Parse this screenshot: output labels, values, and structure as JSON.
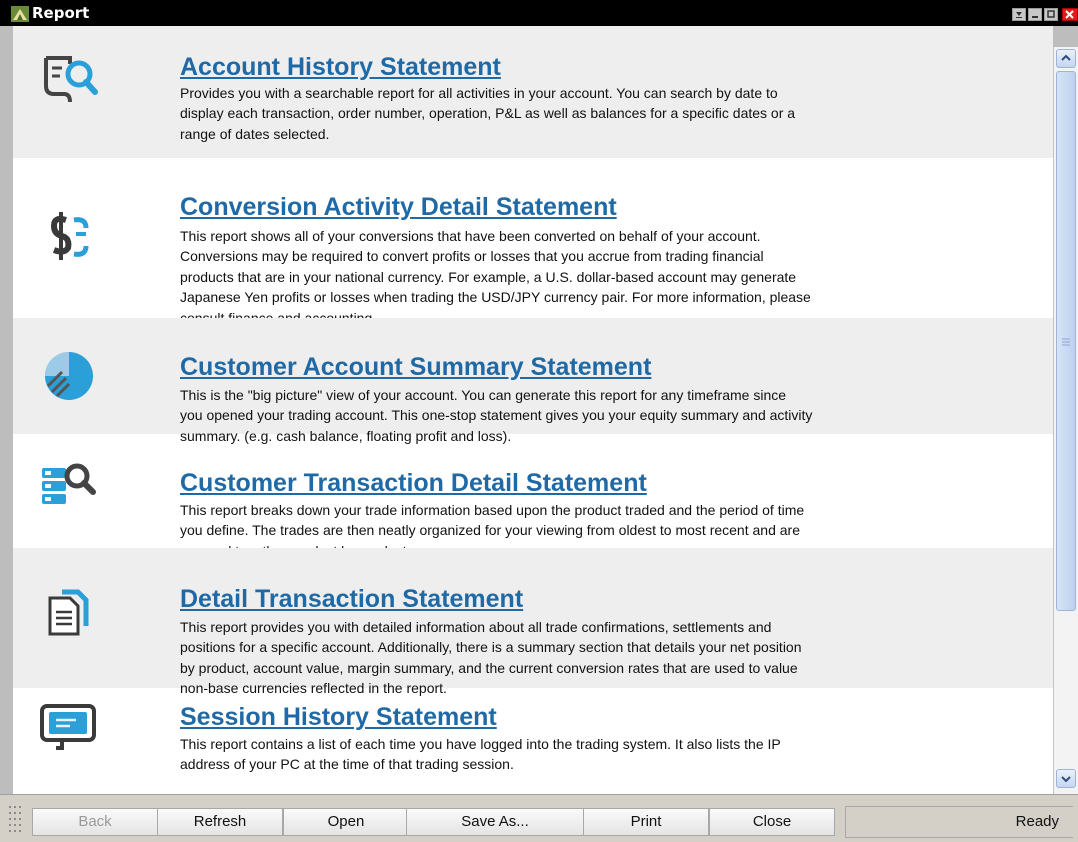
{
  "window": {
    "title": "Report"
  },
  "reports": [
    {
      "title": "Account History Statement",
      "icon": "search-document-icon",
      "lines": [
        "Provides you with a searchable report for all activities in your account. You can search by date to",
        "display each transaction, order number, operation, P&L as well as balances for a specific dates or a",
        "range of dates selected."
      ]
    },
    {
      "title": "Conversion Activity Detail Statement",
      "icon": "dollar-conversion-icon",
      "lines": [
        "This report shows all of your conversions that have been converted on behalf of your account.",
        "Conversions may be required to convert profits or losses that you accrue from trading financial",
        "products that are in your national currency. For example, a U.S. dollar-based account may generate",
        "Japanese Yen profits or losses when trading the USD/JPY currency pair. For more information, please",
        "consult finance and accounting."
      ]
    },
    {
      "title": "Customer Account Summary Statement",
      "icon": "pie-chart-icon",
      "lines": [
        "This is the \"big picture\" view of your account. You can generate this report for any timeframe since",
        "you opened your trading account. This one-stop statement gives you your equity summary and activity",
        "summary. (e.g. cash balance, floating profit and loss)."
      ]
    },
    {
      "title": "Customer Transaction Detail Statement",
      "icon": "database-search-icon",
      "lines": [
        "This report breaks down your trade information based upon the product traded and the period of time",
        "you define. The trades are then neatly organized for your viewing from oldest to most recent and are",
        "grouped together product by product."
      ]
    },
    {
      "title": "Detail Transaction Statement",
      "icon": "documents-icon",
      "lines": [
        "This report provides you with detailed information about all trade confirmations, settlements and",
        "positions for a specific account. Additionally, there is a summary section that details your net position",
        "by product, account value, margin summary, and the current conversion rates that are used to value",
        "non-base currencies reflected in the report."
      ]
    },
    {
      "title": "Session History Statement",
      "icon": "monitor-icon",
      "lines": [
        "This report contains a list of each time you have logged into the trading system. It also lists the IP",
        "address of your PC at the time of that trading session."
      ]
    }
  ],
  "toolbar": {
    "back": "Back",
    "refresh": "Refresh",
    "open": "Open",
    "save_as": "Save As...",
    "print": "Print",
    "close": "Close"
  },
  "status": {
    "text": "Ready"
  }
}
